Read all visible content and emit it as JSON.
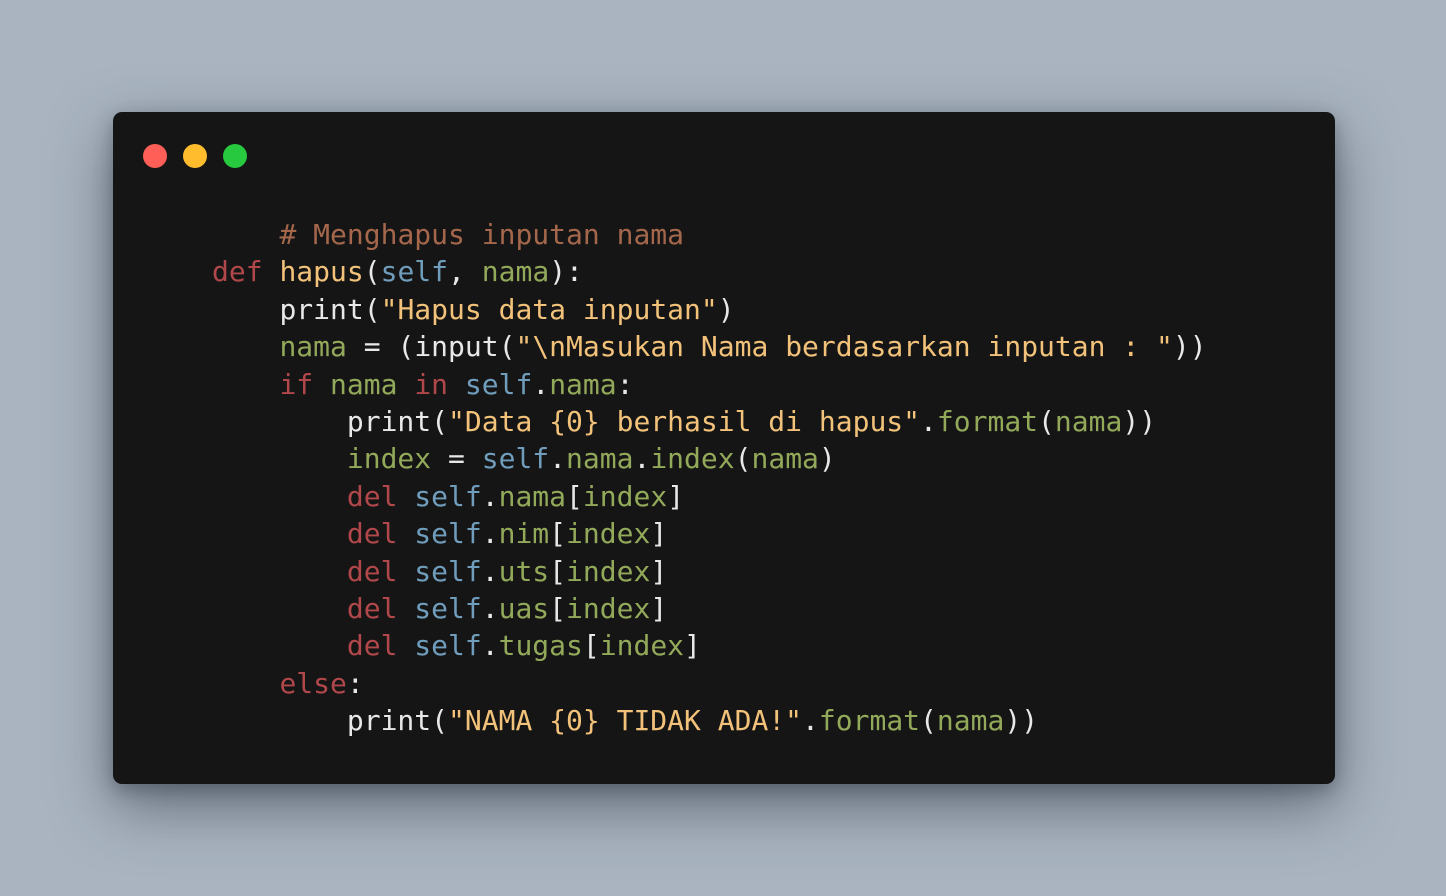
{
  "window": {
    "controls": [
      {
        "name": "close-button",
        "color": "#ff5f56"
      },
      {
        "name": "minimize-button",
        "color": "#ffbd2e"
      },
      {
        "name": "maximize-button",
        "color": "#27c93f"
      }
    ]
  },
  "colors": {
    "background": "#a9b4c0",
    "editor": "#151515",
    "plain": "#e8e8e8",
    "comment": "#a4674c",
    "keyword": "#b0474a",
    "identifier": "#93a95a",
    "self": "#6f9dbb",
    "string": "#f2c27a"
  },
  "code": {
    "lines": [
      {
        "tokens": [
          {
            "t": "    ",
            "k": "plain"
          },
          {
            "t": "# Menghapus inputan nama",
            "k": "comment"
          }
        ]
      },
      {
        "tokens": [
          {
            "t": "def",
            "k": "keyword"
          },
          {
            "t": " ",
            "k": "plain"
          },
          {
            "t": "hapus",
            "k": "string"
          },
          {
            "t": "(",
            "k": "punct"
          },
          {
            "t": "self",
            "k": "self"
          },
          {
            "t": ", ",
            "k": "punct"
          },
          {
            "t": "nama",
            "k": "name"
          },
          {
            "t": "):",
            "k": "punct"
          }
        ]
      },
      {
        "tokens": [
          {
            "t": "    ",
            "k": "plain"
          },
          {
            "t": "print",
            "k": "plain"
          },
          {
            "t": "(",
            "k": "punct"
          },
          {
            "t": "\"Hapus data inputan\"",
            "k": "string"
          },
          {
            "t": ")",
            "k": "punct"
          }
        ]
      },
      {
        "tokens": [
          {
            "t": "    ",
            "k": "plain"
          },
          {
            "t": "nama",
            "k": "name"
          },
          {
            "t": " = (",
            "k": "punct"
          },
          {
            "t": "input",
            "k": "plain"
          },
          {
            "t": "(",
            "k": "punct"
          },
          {
            "t": "\"\\nMasukan Nama berdasarkan inputan : \"",
            "k": "string"
          },
          {
            "t": "))",
            "k": "punct"
          }
        ]
      },
      {
        "tokens": [
          {
            "t": "    ",
            "k": "plain"
          },
          {
            "t": "if",
            "k": "keyword"
          },
          {
            "t": " ",
            "k": "plain"
          },
          {
            "t": "nama",
            "k": "name"
          },
          {
            "t": " ",
            "k": "plain"
          },
          {
            "t": "in",
            "k": "keyword"
          },
          {
            "t": " ",
            "k": "plain"
          },
          {
            "t": "self",
            "k": "self"
          },
          {
            "t": ".",
            "k": "punct"
          },
          {
            "t": "nama",
            "k": "name"
          },
          {
            "t": ":",
            "k": "punct"
          }
        ]
      },
      {
        "tokens": [
          {
            "t": "        ",
            "k": "plain"
          },
          {
            "t": "print",
            "k": "plain"
          },
          {
            "t": "(",
            "k": "punct"
          },
          {
            "t": "\"Data {0} berhasil di hapus\"",
            "k": "string"
          },
          {
            "t": ".",
            "k": "punct"
          },
          {
            "t": "format",
            "k": "name"
          },
          {
            "t": "(",
            "k": "punct"
          },
          {
            "t": "nama",
            "k": "name"
          },
          {
            "t": "))",
            "k": "punct"
          }
        ]
      },
      {
        "tokens": [
          {
            "t": "        ",
            "k": "plain"
          },
          {
            "t": "index",
            "k": "name"
          },
          {
            "t": " = ",
            "k": "punct"
          },
          {
            "t": "self",
            "k": "self"
          },
          {
            "t": ".",
            "k": "punct"
          },
          {
            "t": "nama",
            "k": "name"
          },
          {
            "t": ".",
            "k": "punct"
          },
          {
            "t": "index",
            "k": "name"
          },
          {
            "t": "(",
            "k": "punct"
          },
          {
            "t": "nama",
            "k": "name"
          },
          {
            "t": ")",
            "k": "punct"
          }
        ]
      },
      {
        "tokens": [
          {
            "t": "        ",
            "k": "plain"
          },
          {
            "t": "del",
            "k": "keyword"
          },
          {
            "t": " ",
            "k": "plain"
          },
          {
            "t": "self",
            "k": "self"
          },
          {
            "t": ".",
            "k": "punct"
          },
          {
            "t": "nama",
            "k": "name"
          },
          {
            "t": "[",
            "k": "punct"
          },
          {
            "t": "index",
            "k": "name"
          },
          {
            "t": "]",
            "k": "punct"
          }
        ]
      },
      {
        "tokens": [
          {
            "t": "        ",
            "k": "plain"
          },
          {
            "t": "del",
            "k": "keyword"
          },
          {
            "t": " ",
            "k": "plain"
          },
          {
            "t": "self",
            "k": "self"
          },
          {
            "t": ".",
            "k": "punct"
          },
          {
            "t": "nim",
            "k": "name"
          },
          {
            "t": "[",
            "k": "punct"
          },
          {
            "t": "index",
            "k": "name"
          },
          {
            "t": "]",
            "k": "punct"
          }
        ]
      },
      {
        "tokens": [
          {
            "t": "        ",
            "k": "plain"
          },
          {
            "t": "del",
            "k": "keyword"
          },
          {
            "t": " ",
            "k": "plain"
          },
          {
            "t": "self",
            "k": "self"
          },
          {
            "t": ".",
            "k": "punct"
          },
          {
            "t": "uts",
            "k": "name"
          },
          {
            "t": "[",
            "k": "punct"
          },
          {
            "t": "index",
            "k": "name"
          },
          {
            "t": "]",
            "k": "punct"
          }
        ]
      },
      {
        "tokens": [
          {
            "t": "        ",
            "k": "plain"
          },
          {
            "t": "del",
            "k": "keyword"
          },
          {
            "t": " ",
            "k": "plain"
          },
          {
            "t": "self",
            "k": "self"
          },
          {
            "t": ".",
            "k": "punct"
          },
          {
            "t": "uas",
            "k": "name"
          },
          {
            "t": "[",
            "k": "punct"
          },
          {
            "t": "index",
            "k": "name"
          },
          {
            "t": "]",
            "k": "punct"
          }
        ]
      },
      {
        "tokens": [
          {
            "t": "        ",
            "k": "plain"
          },
          {
            "t": "del",
            "k": "keyword"
          },
          {
            "t": " ",
            "k": "plain"
          },
          {
            "t": "self",
            "k": "self"
          },
          {
            "t": ".",
            "k": "punct"
          },
          {
            "t": "tugas",
            "k": "name"
          },
          {
            "t": "[",
            "k": "punct"
          },
          {
            "t": "index",
            "k": "name"
          },
          {
            "t": "]",
            "k": "punct"
          }
        ]
      },
      {
        "tokens": [
          {
            "t": "    ",
            "k": "plain"
          },
          {
            "t": "else",
            "k": "keyword"
          },
          {
            "t": ":",
            "k": "punct"
          }
        ]
      },
      {
        "tokens": [
          {
            "t": "        ",
            "k": "plain"
          },
          {
            "t": "print",
            "k": "plain"
          },
          {
            "t": "(",
            "k": "punct"
          },
          {
            "t": "\"NAMA {0} TIDAK ADA!\"",
            "k": "string"
          },
          {
            "t": ".",
            "k": "punct"
          },
          {
            "t": "format",
            "k": "name"
          },
          {
            "t": "(",
            "k": "punct"
          },
          {
            "t": "nama",
            "k": "name"
          },
          {
            "t": "))",
            "k": "punct"
          }
        ]
      }
    ]
  }
}
